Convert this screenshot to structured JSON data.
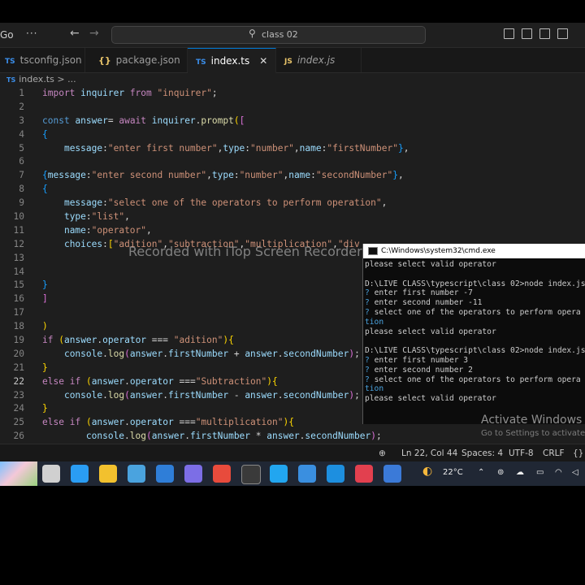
{
  "window": {
    "menu_label": "Go",
    "more_label": "···",
    "search_text": "class 02"
  },
  "tabs": [
    {
      "icon": "{}",
      "label": "tsconfig.json"
    },
    {
      "icon": "{}",
      "label": "package.json"
    },
    {
      "icon": "TS",
      "label": "index.ts",
      "close": "✕"
    },
    {
      "icon": "JS",
      "label": "index.js"
    }
  ],
  "breadcrumb": {
    "icon": "TS",
    "file": "index.ts",
    "sep": ">",
    "more": "..."
  },
  "editor": {
    "line_numbers": [
      "1",
      "2",
      "3",
      "4",
      "5",
      "6",
      "7",
      "8",
      "9",
      "10",
      "11",
      "12",
      "13",
      "14",
      "15",
      "16",
      "17",
      "18",
      "19",
      "20",
      "21",
      "22",
      "23",
      "24",
      "25",
      "26"
    ],
    "current_line": "22",
    "watermark": "Recorded with iTop Screen Recorder",
    "lines": [
      [
        [
          "kw",
          "import"
        ],
        [
          "t",
          " "
        ],
        [
          "var",
          "inquirer"
        ],
        [
          "t",
          " "
        ],
        [
          "kw",
          "from"
        ],
        [
          "t",
          " "
        ],
        [
          "str",
          "\"inquirer\""
        ],
        [
          "t",
          ";"
        ]
      ],
      [],
      [
        [
          "kb",
          "const"
        ],
        [
          "t",
          " "
        ],
        [
          "var",
          "answer"
        ],
        [
          "t",
          "= "
        ],
        [
          "kw",
          "await"
        ],
        [
          "t",
          " "
        ],
        [
          "var",
          "inquirer"
        ],
        [
          "t",
          "."
        ],
        [
          "fn",
          "prompt"
        ],
        [
          "br1",
          "("
        ],
        [
          "br2",
          "["
        ]
      ],
      [
        [
          "br3",
          "{"
        ]
      ],
      [
        [
          "t",
          "    "
        ],
        [
          "var",
          "message"
        ],
        [
          "t",
          ":"
        ],
        [
          "str",
          "\"enter first number\""
        ],
        [
          "t",
          ","
        ],
        [
          "var",
          "type"
        ],
        [
          "t",
          ":"
        ],
        [
          "str",
          "\"number\""
        ],
        [
          "t",
          ","
        ],
        [
          "var",
          "name"
        ],
        [
          "t",
          ":"
        ],
        [
          "str",
          "\"firstNumber\""
        ],
        [
          "br3",
          "}"
        ],
        [
          "t",
          ","
        ]
      ],
      [],
      [
        [
          "br3",
          "{"
        ],
        [
          "var",
          "message"
        ],
        [
          "t",
          ":"
        ],
        [
          "str",
          "\"enter second number\""
        ],
        [
          "t",
          ","
        ],
        [
          "var",
          "type"
        ],
        [
          "t",
          ":"
        ],
        [
          "str",
          "\"number\""
        ],
        [
          "t",
          ","
        ],
        [
          "var",
          "name"
        ],
        [
          "t",
          ":"
        ],
        [
          "str",
          "\"secondNumber\""
        ],
        [
          "br3",
          "}"
        ],
        [
          "t",
          ","
        ]
      ],
      [
        [
          "br3",
          "{"
        ]
      ],
      [
        [
          "t",
          "    "
        ],
        [
          "var",
          "message"
        ],
        [
          "t",
          ":"
        ],
        [
          "str",
          "\"select one of the operators to perform operation\""
        ],
        [
          "t",
          ","
        ]
      ],
      [
        [
          "t",
          "    "
        ],
        [
          "var",
          "type"
        ],
        [
          "t",
          ":"
        ],
        [
          "str",
          "\"list\""
        ],
        [
          "t",
          ","
        ]
      ],
      [
        [
          "t",
          "    "
        ],
        [
          "var",
          "name"
        ],
        [
          "t",
          ":"
        ],
        [
          "str",
          "\"operator\""
        ],
        [
          "t",
          ","
        ]
      ],
      [
        [
          "t",
          "    "
        ],
        [
          "var",
          "choices"
        ],
        [
          "t",
          ":"
        ],
        [
          "br1",
          "["
        ],
        [
          "str",
          "\"adition\""
        ],
        [
          "t",
          ","
        ],
        [
          "str",
          "\"subtraction\""
        ],
        [
          "t",
          ","
        ],
        [
          "str",
          "\"multiplication\""
        ],
        [
          "t",
          ","
        ],
        [
          "str",
          "\"div"
        ]
      ],
      [],
      [],
      [
        [
          "br3",
          "}"
        ]
      ],
      [
        [
          "br2",
          "]"
        ]
      ],
      [],
      [
        [
          "br1",
          ")"
        ]
      ],
      [
        [
          "kw",
          "if"
        ],
        [
          "t",
          " "
        ],
        [
          "br1",
          "("
        ],
        [
          "var",
          "answer"
        ],
        [
          "t",
          "."
        ],
        [
          "var",
          "operator"
        ],
        [
          "t",
          " === "
        ],
        [
          "str",
          "\"adition\""
        ],
        [
          "br1",
          ")"
        ],
        [
          "br1",
          "{"
        ]
      ],
      [
        [
          "t",
          "    "
        ],
        [
          "var",
          "console"
        ],
        [
          "t",
          "."
        ],
        [
          "fn",
          "log"
        ],
        [
          "br2",
          "("
        ],
        [
          "var",
          "answer"
        ],
        [
          "t",
          "."
        ],
        [
          "var",
          "firstNumber"
        ],
        [
          "t",
          " + "
        ],
        [
          "var",
          "answer"
        ],
        [
          "t",
          "."
        ],
        [
          "var",
          "secondNumber"
        ],
        [
          "br2",
          ")"
        ],
        [
          "t",
          ";"
        ]
      ],
      [
        [
          "br1",
          "}"
        ]
      ],
      [
        [
          "kw",
          "else"
        ],
        [
          "t",
          " "
        ],
        [
          "kw",
          "if"
        ],
        [
          "t",
          " "
        ],
        [
          "br1",
          "("
        ],
        [
          "var",
          "answer"
        ],
        [
          "t",
          "."
        ],
        [
          "var",
          "operator"
        ],
        [
          "t",
          " ==="
        ],
        [
          "str",
          "\"Subtraction\""
        ],
        [
          "br1",
          ")"
        ],
        [
          "br1",
          "{"
        ]
      ],
      [
        [
          "t",
          "    "
        ],
        [
          "var",
          "console"
        ],
        [
          "t",
          "."
        ],
        [
          "fn",
          "log"
        ],
        [
          "br2",
          "("
        ],
        [
          "var",
          "answer"
        ],
        [
          "t",
          "."
        ],
        [
          "var",
          "firstNumber"
        ],
        [
          "t",
          " - "
        ],
        [
          "var",
          "answer"
        ],
        [
          "t",
          "."
        ],
        [
          "var",
          "secondNumber"
        ],
        [
          "br2",
          ")"
        ],
        [
          "t",
          ";"
        ]
      ],
      [
        [
          "br1",
          "}"
        ]
      ],
      [
        [
          "kw",
          "else"
        ],
        [
          "t",
          " "
        ],
        [
          "kw",
          "if"
        ],
        [
          "t",
          " "
        ],
        [
          "br1",
          "("
        ],
        [
          "var",
          "answer"
        ],
        [
          "t",
          "."
        ],
        [
          "var",
          "operator"
        ],
        [
          "t",
          " ==="
        ],
        [
          "str",
          "\"multiplication\""
        ],
        [
          "br1",
          ")"
        ],
        [
          "br1",
          "{"
        ]
      ],
      [
        [
          "t",
          "        "
        ],
        [
          "var",
          "console"
        ],
        [
          "t",
          "."
        ],
        [
          "fn",
          "log"
        ],
        [
          "br2",
          "("
        ],
        [
          "var",
          "answer"
        ],
        [
          "t",
          "."
        ],
        [
          "var",
          "firstNumber"
        ],
        [
          "t",
          " * "
        ],
        [
          "var",
          "answer"
        ],
        [
          "t",
          "."
        ],
        [
          "var",
          "secondNumber"
        ],
        [
          "br2",
          ")"
        ],
        [
          "t",
          ";"
        ]
      ]
    ]
  },
  "terminal": {
    "title": "C:\\Windows\\system32\\cmd.exe",
    "lines": [
      [
        [
          "t",
          "please select valid operator"
        ]
      ],
      [],
      [
        [
          "t",
          "D:\\LIVE CLASS\\typescript\\class 02>node index.js"
        ]
      ],
      [
        [
          "q",
          "? "
        ],
        [
          "t",
          "enter first number -7"
        ]
      ],
      [
        [
          "q",
          "? "
        ],
        [
          "t",
          "enter second number -11"
        ]
      ],
      [
        [
          "q",
          "? "
        ],
        [
          "t",
          "select one of the operators to perform opera"
        ]
      ],
      [
        [
          "cy",
          "tion"
        ]
      ],
      [
        [
          "t",
          "please select valid operator"
        ]
      ],
      [],
      [
        [
          "t",
          "D:\\LIVE CLASS\\typescript\\class 02>node index.js"
        ]
      ],
      [
        [
          "q",
          "? "
        ],
        [
          "t",
          "enter first number 3"
        ]
      ],
      [
        [
          "q",
          "? "
        ],
        [
          "t",
          "enter second number 2"
        ]
      ],
      [
        [
          "q",
          "? "
        ],
        [
          "t",
          "select one of the operators to perform opera"
        ]
      ],
      [
        [
          "cy",
          "tion"
        ]
      ],
      [
        [
          "t",
          "please select valid operator"
        ]
      ]
    ]
  },
  "activation": {
    "title": "Activate Windows",
    "subtitle": "Go to Settings to activate"
  },
  "statusbar": {
    "position": "Ln 22, Col 44",
    "spaces": "Spaces: 4",
    "encoding": "UTF-8",
    "eol": "CRLF",
    "lang": "{}"
  },
  "taskbar": {
    "weather": "22°C",
    "icons": [
      {
        "name": "task-view-icon",
        "color": "#d0d0d0"
      },
      {
        "name": "edge-icon",
        "color": "#2a9df4"
      },
      {
        "name": "file-explorer-icon",
        "color": "#f2c12e"
      },
      {
        "name": "store-icon",
        "color": "#4aa3df"
      },
      {
        "name": "mail-icon",
        "color": "#2f7ed8"
      },
      {
        "name": "media-icon",
        "color": "#7c6ee6"
      },
      {
        "name": "chrome-icon",
        "color": "#e84b3c"
      },
      {
        "name": "cmd-icon",
        "color": "#3a3a3a"
      },
      {
        "name": "vscode-icon",
        "color": "#22a6f0"
      },
      {
        "name": "paint-icon",
        "color": "#3a8fe0"
      },
      {
        "name": "vscode-2-icon",
        "color": "#1d8fe0"
      },
      {
        "name": "recorder-icon",
        "color": "#e2404f"
      },
      {
        "name": "shield-icon",
        "color": "#3b7ad8"
      }
    ]
  }
}
